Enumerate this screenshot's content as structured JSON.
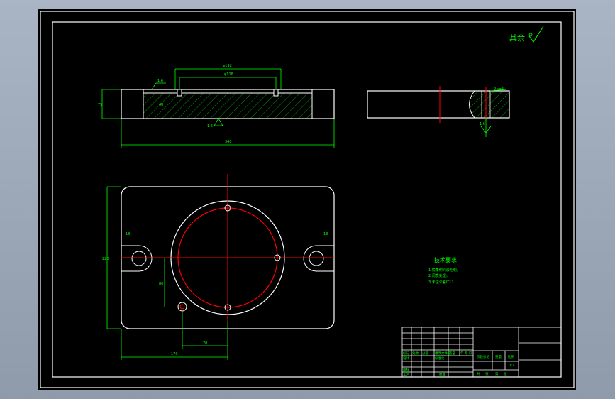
{
  "colors": {
    "background": "#000000",
    "outline": "#ffffff",
    "dimension": "#00ff00",
    "centerline": "#ff0000",
    "border": "#ffffff"
  },
  "roughness_note": "其余",
  "tech_requirements": {
    "title": "技术要求",
    "lines": [
      "1.锐角倒钝去毛刺。",
      "2.调质处理。",
      "3.未注公差IT12"
    ]
  },
  "front_view": {
    "dims": {
      "top_outer": "φ192",
      "top_inner": "φ118",
      "left_height": "75",
      "left_inner": "40",
      "overall_width": "340",
      "roughness_top": "1.6",
      "roughness_bottom": "1.6"
    }
  },
  "side_view": {
    "dims": {
      "hole": "2×φ8",
      "roughness": "1.6"
    }
  },
  "plan_view": {
    "dims": {
      "overall_height": "220",
      "slot_left": "18",
      "slot_right": "18",
      "hole_offset_y": "80",
      "hole_offset_x": "70",
      "half_width": "170"
    }
  },
  "title_block": {
    "cells": [
      "标记",
      "处数",
      "分区",
      "更改文件号",
      "签名",
      "年.月.日",
      "设计",
      "标准化",
      "审核",
      "工艺",
      "批准",
      "阶段标记",
      "重量",
      "比例",
      "共",
      "张",
      "第",
      "张",
      "1:1"
    ]
  }
}
